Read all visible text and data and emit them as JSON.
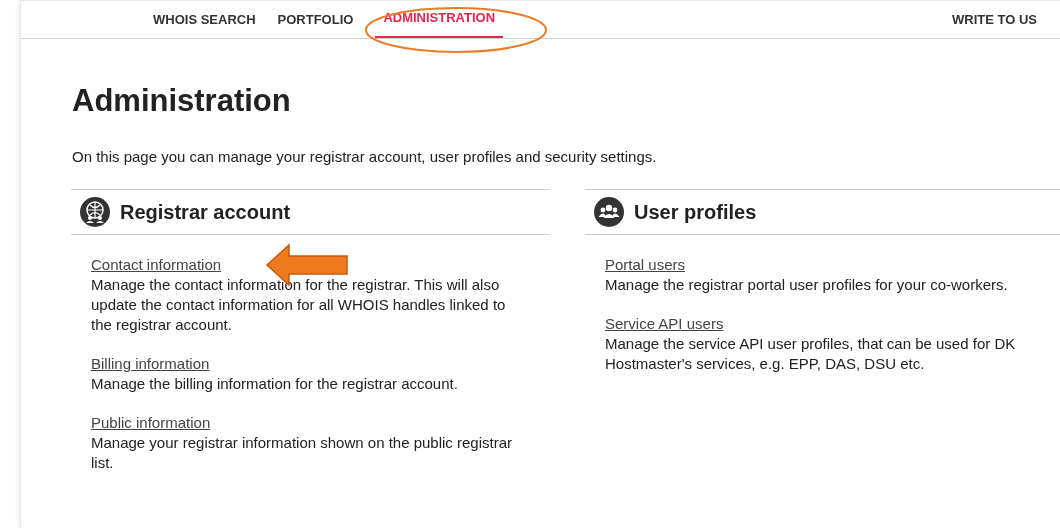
{
  "nav": {
    "items": [
      {
        "label": "WHOIS SEARCH",
        "selected": false
      },
      {
        "label": "PORTFOLIO",
        "selected": false
      },
      {
        "label": "ADMINISTRATION",
        "selected": true
      }
    ],
    "contact": "WRITE TO US"
  },
  "title": "Administration",
  "intro": "On this page you can manage your registrar account, user profiles and security settings.",
  "sections": [
    {
      "kind": "account",
      "title": "Registrar account",
      "links": [
        {
          "label": "Contact information",
          "description": "Manage the contact information for the registrar. This will also update the contact information for all WHOIS handles linked to the registrar account.",
          "annotated": true
        },
        {
          "label": "Billing information",
          "description": "Manage the billing information for the registrar account.",
          "annotated": false
        },
        {
          "label": "Public information",
          "description": "Manage your registrar information shown on the public registrar list.",
          "annotated": false
        }
      ]
    },
    {
      "kind": "users",
      "title": "User profiles",
      "links": [
        {
          "label": "Portal users",
          "description": "Manage the registrar portal user profiles for your co-workers.",
          "annotated": false
        },
        {
          "label": "Service API users",
          "description": "Manage the service API user profiles, that can be used for DK Hostmaster's services, e.g. EPP, DAS, DSU etc.",
          "annotated": false
        }
      ]
    }
  ]
}
